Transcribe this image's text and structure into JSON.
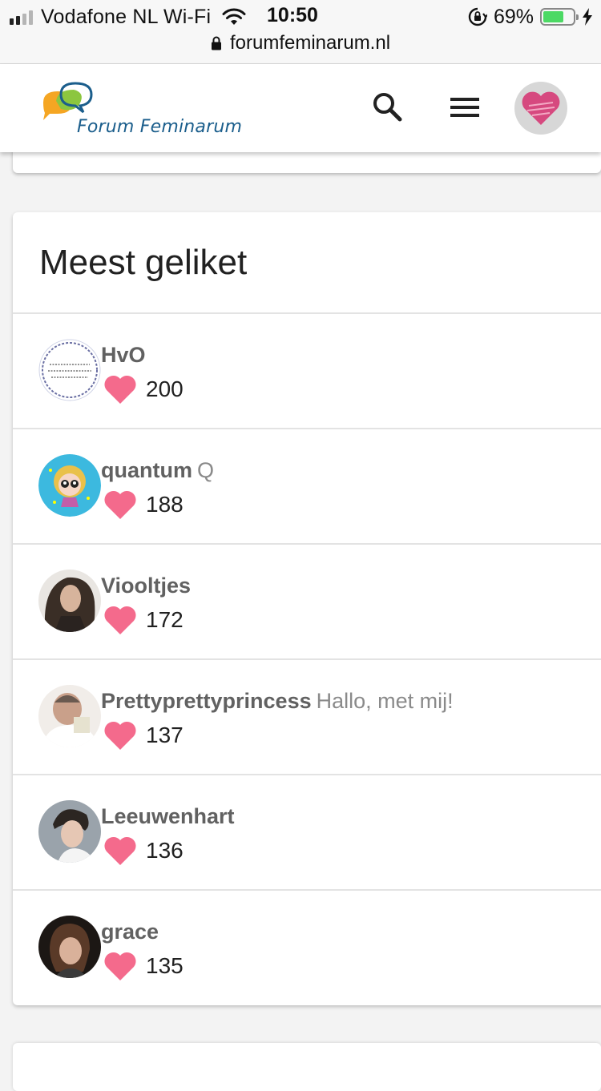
{
  "status_bar": {
    "carrier": "Vodafone NL Wi-Fi",
    "time": "10:50",
    "battery_percent": "69%",
    "battery_level": 0.69,
    "url": "forumfeminarum.nl"
  },
  "header": {
    "logo_text": "Forum Feminarum",
    "search_icon": "search-icon",
    "menu_icon": "hamburger-menu-icon",
    "avatar": "user-avatar"
  },
  "section": {
    "title": "Meest geliket"
  },
  "users": [
    {
      "username": "HvO",
      "fullname": "",
      "likes": "200",
      "avatar_color": "#ffffff"
    },
    {
      "username": "quantum",
      "fullname": "Q",
      "likes": "188",
      "avatar_color": "#3cb9df"
    },
    {
      "username": "Viooltjes",
      "fullname": "",
      "likes": "172",
      "avatar_color": "#3a2e26"
    },
    {
      "username": "Prettyprettyprincess",
      "fullname": "Hallo, met mij!",
      "likes": "137",
      "avatar_color": "#c9b8ab"
    },
    {
      "username": "Leeuwenhart",
      "fullname": "",
      "likes": "136",
      "avatar_color": "#9aa3ab"
    },
    {
      "username": "grace",
      "fullname": "",
      "likes": "135",
      "avatar_color": "#2e241e"
    }
  ],
  "colors": {
    "heart": "#f46a8c",
    "username": "#616161",
    "battery": "#4cd964"
  }
}
